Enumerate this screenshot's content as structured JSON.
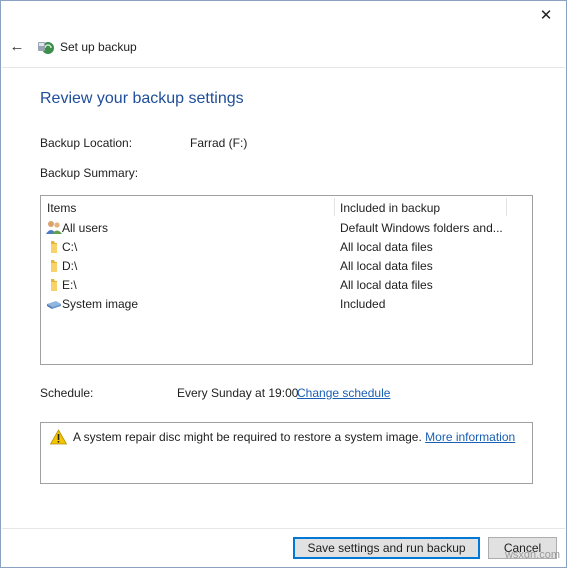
{
  "window": {
    "title": "Set up backup",
    "close_glyph": "✕",
    "back_glyph": "←"
  },
  "heading": "Review your backup settings",
  "backup_location": {
    "label": "Backup Location:",
    "value": "Farrad (F:)"
  },
  "backup_summary": {
    "label": "Backup Summary:"
  },
  "table": {
    "headers": [
      "Items",
      "Included in backup"
    ],
    "rows": [
      {
        "icon": "users-icon",
        "name": "All users",
        "included": "Default Windows folders and..."
      },
      {
        "icon": "drive-folder-icon",
        "name": "C:\\",
        "included": "All local data files"
      },
      {
        "icon": "drive-folder-icon",
        "name": "D:\\",
        "included": "All local data files"
      },
      {
        "icon": "drive-folder-icon",
        "name": "E:\\",
        "included": "All local data files"
      },
      {
        "icon": "system-image-icon",
        "name": "System image",
        "included": "Included"
      }
    ]
  },
  "schedule": {
    "label": "Schedule:",
    "value": "Every Sunday at 19:00",
    "change_link": "Change schedule"
  },
  "warning": {
    "text": "A system repair disc might be required to restore a system image.",
    "link": "More information"
  },
  "buttons": {
    "save_run": "Save settings and run backup",
    "cancel": "Cancel"
  },
  "watermark": "wsxdn.com",
  "colors": {
    "heading": "#1f4e99",
    "link": "#1a5fb4",
    "primary_border": "#0078d7",
    "warning": "#f5c400"
  }
}
